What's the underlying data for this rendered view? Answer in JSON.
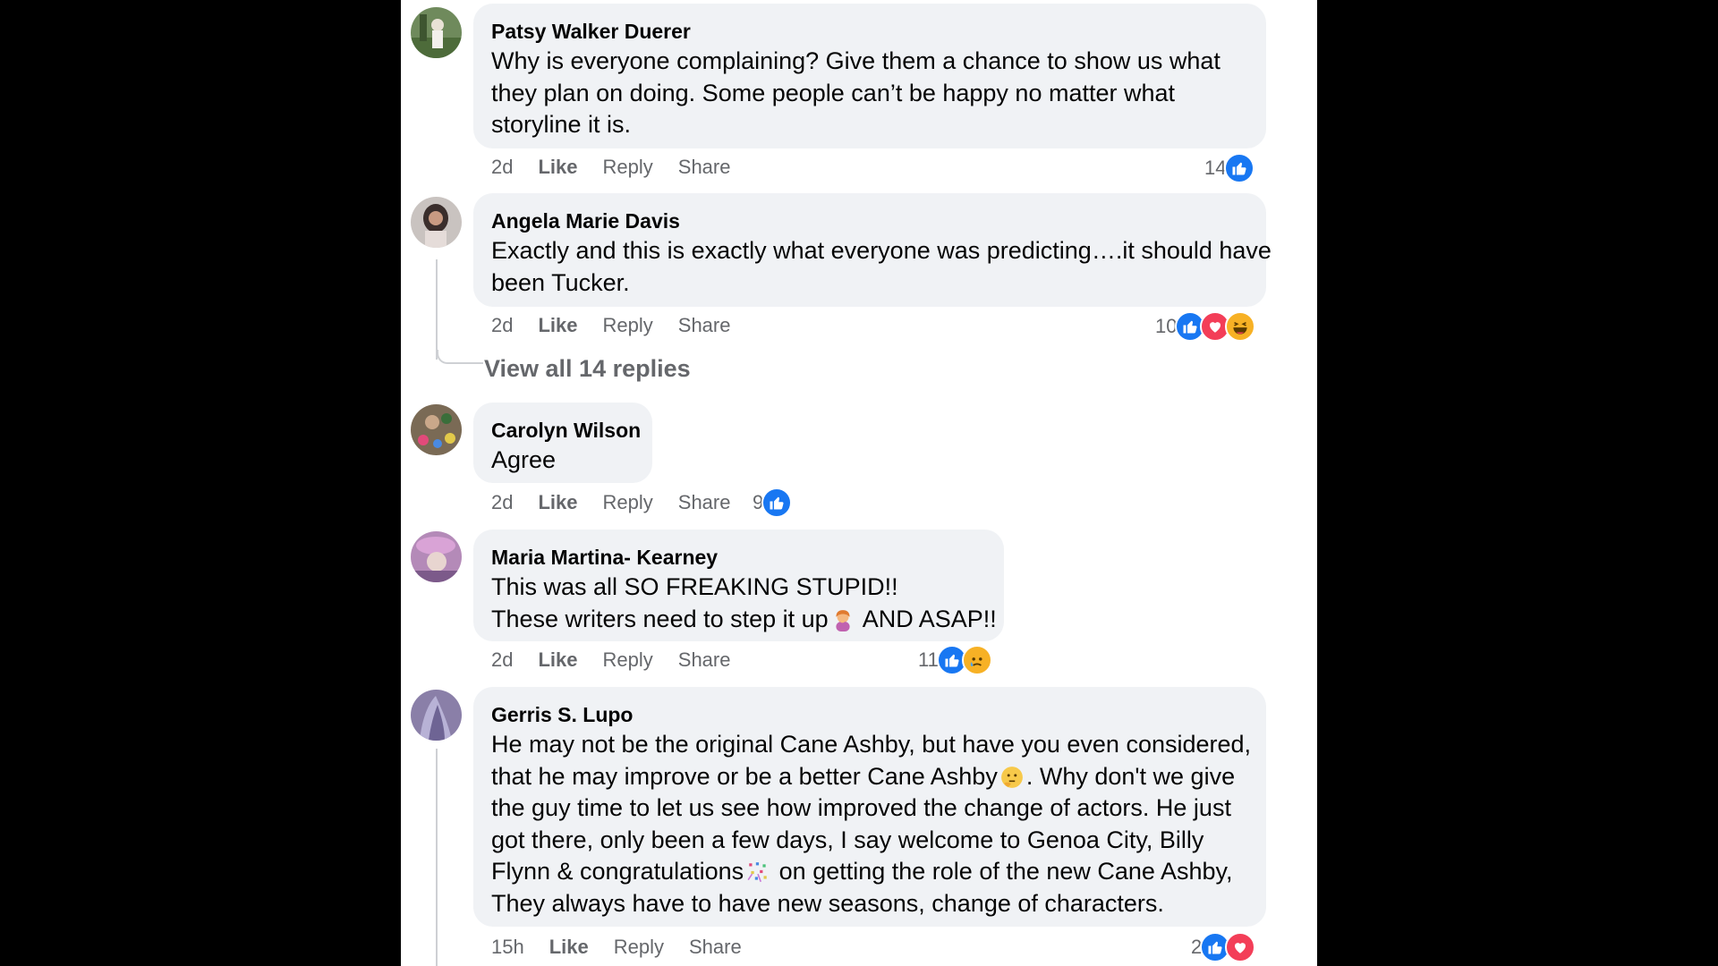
{
  "comments": [
    {
      "author": "Patsy Walker Duerer",
      "lines": [
        "Why is everyone complaining? Give them a chance to show us what",
        "they plan on doing. Some people can’t be happy no matter what",
        "storyline it is."
      ],
      "age": "2d",
      "actions": {
        "like": "Like",
        "reply": "Reply",
        "share": "Share"
      },
      "reaction_count": "14",
      "reactions": [
        "like"
      ]
    },
    {
      "author": "Angela Marie Davis",
      "lines": [
        "Exactly and this is exactly what everyone was predicting….it should have",
        "been Tucker."
      ],
      "age": "2d",
      "actions": {
        "like": "Like",
        "reply": "Reply",
        "share": "Share"
      },
      "reaction_count": "10",
      "reactions": [
        "like",
        "love",
        "haha"
      ],
      "view_replies": "View all 14 replies"
    },
    {
      "author": "Carolyn Wilson",
      "lines": [
        "Agree"
      ],
      "age": "2d",
      "actions": {
        "like": "Like",
        "reply": "Reply",
        "share": "Share"
      },
      "reaction_count": "9",
      "reactions": [
        "like"
      ]
    },
    {
      "author": "Maria Martina- Kearney",
      "lines": [
        "This was all SO FREAKING STUPID!!",
        "These writers need to step it up",
        " AND ASAP!!"
      ],
      "age": "2d",
      "actions": {
        "like": "Like",
        "reply": "Reply",
        "share": "Share"
      },
      "reaction_count": "11",
      "reactions": [
        "like",
        "sad"
      ]
    },
    {
      "author": "Gerris S. Lupo",
      "lines": [
        "He may not be the original Cane Ashby, but have you even considered,",
        "that he may improve or be a better Cane Ashby",
        ". Why don't we give",
        "the guy time to let us see how improved the change of actors. He just",
        "got there, only been a few days, I say welcome to Genoa City, Billy",
        "Flynn & congratulations",
        " on getting the role of the new Cane Ashby,",
        "They always have to have new seasons, change of characters."
      ],
      "age": "15h",
      "actions": {
        "like": "Like",
        "reply": "Reply",
        "share": "Share"
      },
      "reaction_count": "2",
      "reactions": [
        "like",
        "love"
      ]
    }
  ],
  "colors": {
    "like": "#1877f2",
    "love": "#f33e58",
    "haha": "#f7b125",
    "bubble": "#f0f2f5",
    "meta_text": "#65676b"
  }
}
